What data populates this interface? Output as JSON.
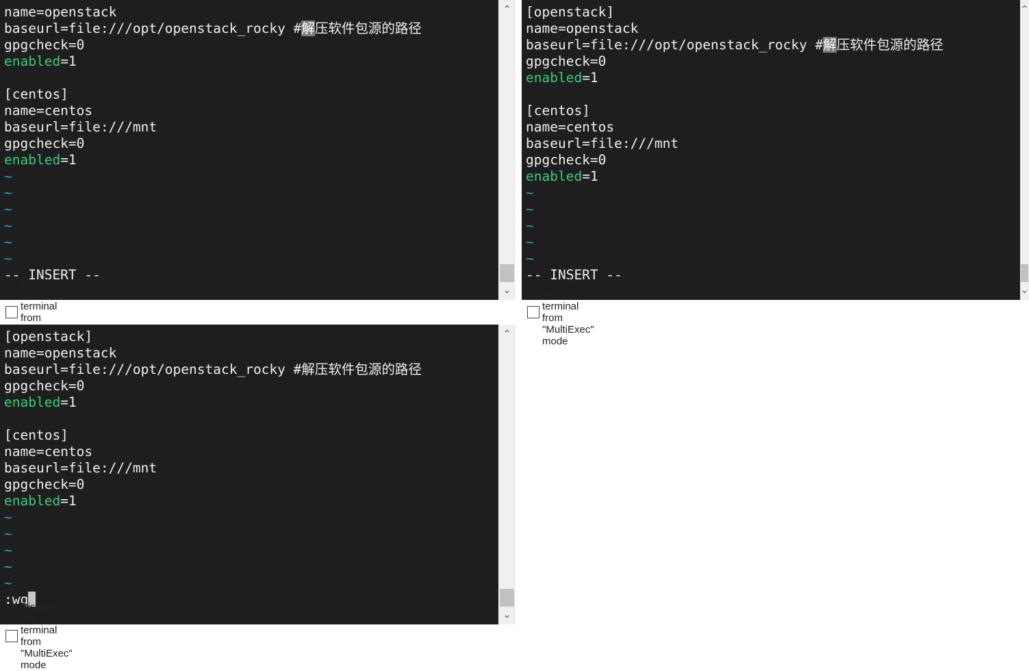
{
  "panes": [
    {
      "lines": [
        {
          "parts": [
            {
              "t": "name=openstack"
            }
          ]
        },
        {
          "parts": [
            {
              "t": "baseurl=file:///opt/openstack_rocky #"
            },
            {
              "t": "解",
              "c": "hl"
            },
            {
              "t": "压软件包源的路径"
            }
          ]
        },
        {
          "parts": [
            {
              "t": "gpgcheck=0"
            }
          ]
        },
        {
          "parts": [
            {
              "t": "enabled",
              "c": "kw"
            },
            {
              "t": "=1"
            }
          ]
        },
        {
          "parts": []
        },
        {
          "parts": [
            {
              "t": "[centos]"
            }
          ]
        },
        {
          "parts": [
            {
              "t": "name=centos"
            }
          ]
        },
        {
          "parts": [
            {
              "t": "baseurl=file:///mnt"
            }
          ]
        },
        {
          "parts": [
            {
              "t": "gpgcheck=0"
            }
          ]
        },
        {
          "parts": [
            {
              "t": "enabled",
              "c": "kw"
            },
            {
              "t": "=1"
            }
          ]
        },
        {
          "parts": [
            {
              "t": "~",
              "c": "tilde"
            }
          ]
        },
        {
          "parts": [
            {
              "t": "~",
              "c": "tilde"
            }
          ]
        },
        {
          "parts": [
            {
              "t": "~",
              "c": "tilde"
            }
          ]
        },
        {
          "parts": [
            {
              "t": "~",
              "c": "tilde"
            }
          ]
        },
        {
          "parts": [
            {
              "t": "~",
              "c": "tilde"
            }
          ]
        },
        {
          "parts": [
            {
              "t": "~",
              "c": "tilde"
            }
          ]
        },
        {
          "parts": [
            {
              "t": "-- INSERT --"
            }
          ]
        }
      ],
      "scroll_position": 0.95,
      "multiexec_label": "Disable this terminal from \"MultiExec\" mode"
    },
    {
      "lines": [
        {
          "parts": [
            {
              "t": "[openstack]"
            }
          ]
        },
        {
          "parts": [
            {
              "t": "name=openstack"
            }
          ]
        },
        {
          "parts": [
            {
              "t": "baseurl=file:///opt/openstack_rocky #"
            },
            {
              "t": "解",
              "c": "hl"
            },
            {
              "t": "压软件包源的路径"
            }
          ]
        },
        {
          "parts": [
            {
              "t": "gpgcheck=0"
            }
          ]
        },
        {
          "parts": [
            {
              "t": "enabled",
              "c": "kw"
            },
            {
              "t": "=1"
            }
          ]
        },
        {
          "parts": []
        },
        {
          "parts": [
            {
              "t": "[centos]"
            }
          ]
        },
        {
          "parts": [
            {
              "t": "name=centos"
            }
          ]
        },
        {
          "parts": [
            {
              "t": "baseurl=file:///mnt"
            }
          ]
        },
        {
          "parts": [
            {
              "t": "gpgcheck=0"
            }
          ]
        },
        {
          "parts": [
            {
              "t": "enabled",
              "c": "kw"
            },
            {
              "t": "=1"
            }
          ]
        },
        {
          "parts": [
            {
              "t": "~",
              "c": "tilde"
            }
          ]
        },
        {
          "parts": [
            {
              "t": "~",
              "c": "tilde"
            }
          ]
        },
        {
          "parts": [
            {
              "t": "~",
              "c": "tilde"
            }
          ]
        },
        {
          "parts": [
            {
              "t": "~",
              "c": "tilde"
            }
          ]
        },
        {
          "parts": [
            {
              "t": "~",
              "c": "tilde"
            }
          ]
        },
        {
          "parts": [
            {
              "t": "-- INSERT --"
            }
          ]
        }
      ],
      "scroll_position": 0.95,
      "multiexec_label": "Disable this terminal from \"MultiExec\" mode"
    },
    {
      "lines": [
        {
          "parts": [
            {
              "t": "[openstack]"
            }
          ]
        },
        {
          "parts": [
            {
              "t": "name=openstack"
            }
          ]
        },
        {
          "parts": [
            {
              "t": "baseurl=file:///opt/openstack_rocky #解压软件包源的路径"
            }
          ]
        },
        {
          "parts": [
            {
              "t": "gpgcheck=0"
            }
          ]
        },
        {
          "parts": [
            {
              "t": "enabled",
              "c": "kw"
            },
            {
              "t": "=1"
            }
          ]
        },
        {
          "parts": []
        },
        {
          "parts": [
            {
              "t": "[centos]"
            }
          ]
        },
        {
          "parts": [
            {
              "t": "name=centos"
            }
          ]
        },
        {
          "parts": [
            {
              "t": "baseurl=file:///mnt"
            }
          ]
        },
        {
          "parts": [
            {
              "t": "gpgcheck=0"
            }
          ]
        },
        {
          "parts": [
            {
              "t": "enabled",
              "c": "kw"
            },
            {
              "t": "=1"
            }
          ]
        },
        {
          "parts": [
            {
              "t": "~",
              "c": "tilde"
            }
          ]
        },
        {
          "parts": [
            {
              "t": "~",
              "c": "tilde"
            }
          ]
        },
        {
          "parts": [
            {
              "t": "~",
              "c": "tilde"
            }
          ]
        },
        {
          "parts": [
            {
              "t": "~",
              "c": "tilde"
            }
          ]
        },
        {
          "parts": [
            {
              "t": "~",
              "c": "tilde"
            }
          ]
        },
        {
          "parts": [
            {
              "t": ":wq"
            },
            {
              "t": "",
              "c": "cursor"
            }
          ]
        }
      ],
      "scroll_position": 0.95,
      "multiexec_label": "Disable this terminal from \"MultiExec\" mode"
    }
  ],
  "icons": {
    "scroll_up": "chevron-up-icon",
    "scroll_down": "chevron-down-icon"
  },
  "colors": {
    "terminal_bg": "#1e1e1e",
    "text": "#f0f0f0",
    "keyword": "#33d17a",
    "tilde": "#2a9fd6",
    "selection": "#7b7b7b"
  }
}
